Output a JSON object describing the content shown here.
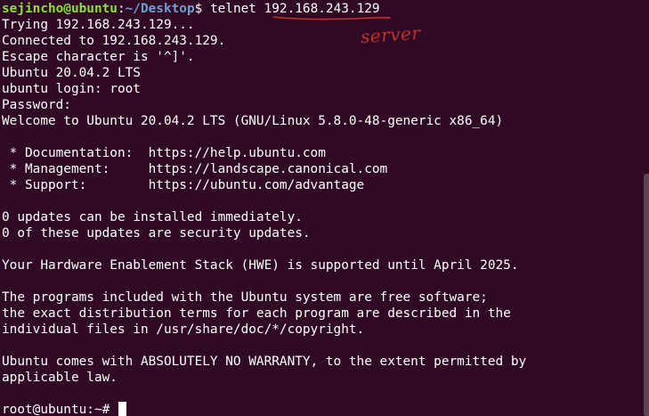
{
  "prompt_top": {
    "user_host": "sejincho@ubuntu",
    "sep": ":",
    "path": "~/Desktop",
    "dollar": "$ ",
    "command": "telnet ",
    "ip": "192.168.243.129"
  },
  "annotation": {
    "text": "server",
    "color": "#c0302c"
  },
  "output_lines": [
    "Trying 192.168.243.129...",
    "Connected to 192.168.243.129.",
    "Escape character is '^]'.",
    "Ubuntu 20.04.2 LTS",
    "ubuntu login: root",
    "Password:",
    "Welcome to Ubuntu 20.04.2 LTS (GNU/Linux 5.8.0-48-generic x86_64)",
    "",
    " * Documentation:  https://help.ubuntu.com",
    " * Management:     https://landscape.canonical.com",
    " * Support:        https://ubuntu.com/advantage",
    "",
    "0 updates can be installed immediately.",
    "0 of these updates are security updates.",
    "",
    "Your Hardware Enablement Stack (HWE) is supported until April 2025.",
    "",
    "The programs included with the Ubuntu system are free software;",
    "the exact distribution terms for each program are described in the",
    "individual files in /usr/share/doc/*/copyright.",
    "",
    "Ubuntu comes with ABSOLUTELY NO WARRANTY, to the extent permitted by",
    "applicable law.",
    ""
  ],
  "final_prompt": "root@ubuntu:~# ",
  "colors": {
    "background": "#300a24",
    "user_host": "#8ae234",
    "path": "#729fcf",
    "text": "#ffffff"
  }
}
